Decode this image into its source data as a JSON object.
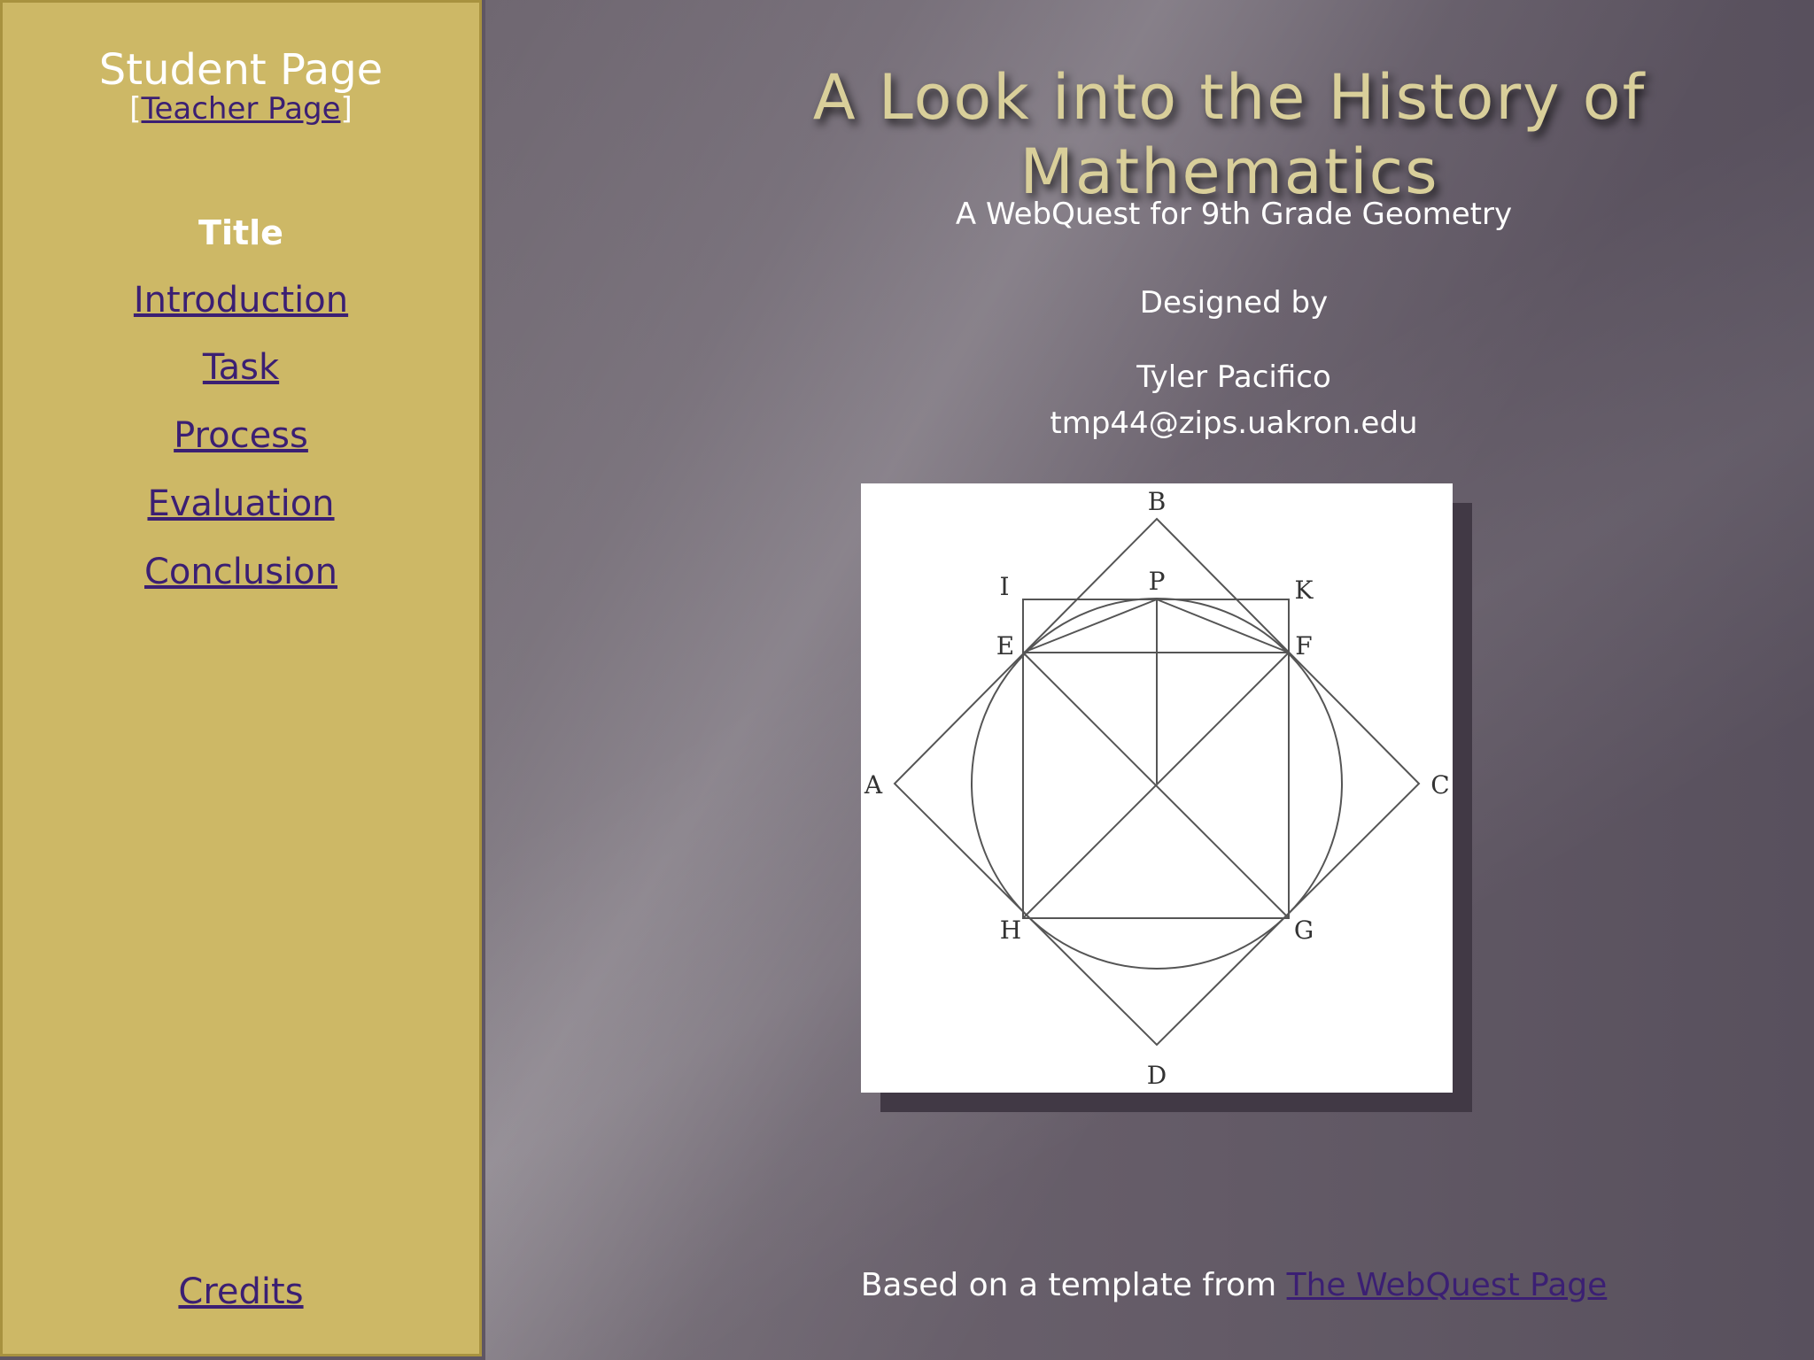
{
  "sidebar": {
    "title": "Student Page",
    "teacher_open": "[",
    "teacher_link": "Teacher Page",
    "teacher_close": "]",
    "current": "Title",
    "nav": [
      "Introduction",
      "Task",
      "Process",
      "Evaluation",
      "Conclusion"
    ],
    "credits": "Credits"
  },
  "main": {
    "title": "A Look into the History of Mathematics",
    "subtitle": "A WebQuest for 9th Grade Geometry",
    "designed_by": "Designed by",
    "author": "Tyler Pacifico",
    "email": "tmp44@zips.uakron.edu",
    "footer_prefix": "Based on a template from ",
    "footer_link": "The WebQuest Page"
  },
  "figure": {
    "labels": [
      "B",
      "I",
      "P",
      "K",
      "E",
      "F",
      "A",
      "C",
      "H",
      "G",
      "D"
    ]
  }
}
